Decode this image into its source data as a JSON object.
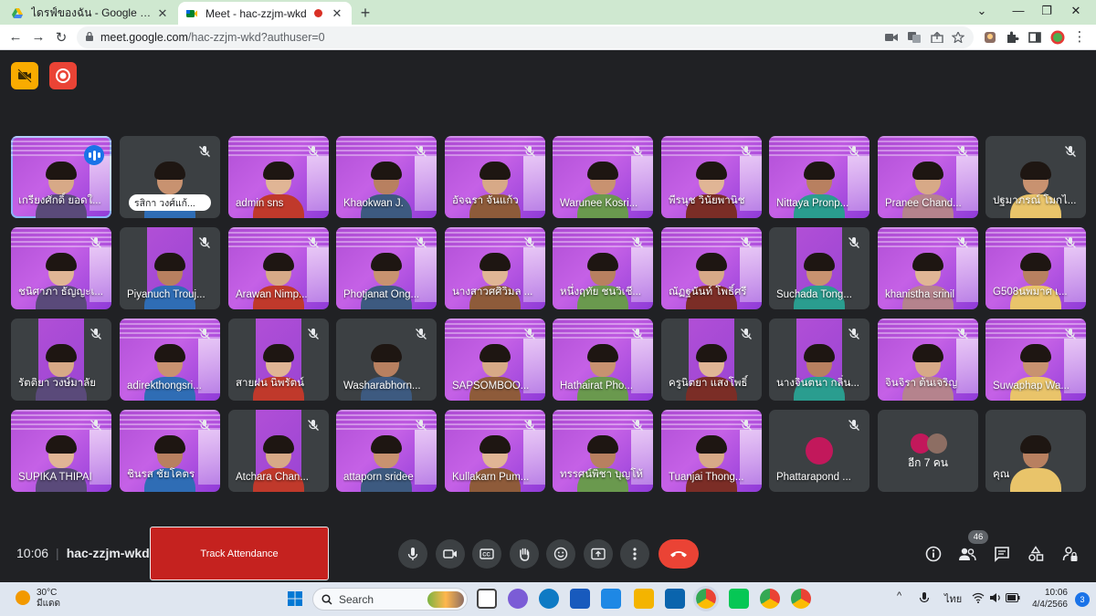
{
  "browser": {
    "tabs": [
      {
        "title": "ไดรฟ์ของฉัน - Google ไดรฟ์",
        "close": "✕"
      },
      {
        "title": "Meet - hac-zzjm-wkd",
        "close": "✕"
      }
    ],
    "new_tab": "+",
    "window_controls": {
      "collapse": "⌄",
      "minimize": "—",
      "maximize": "❐",
      "close": "✕"
    },
    "nav": {
      "back": "←",
      "forward": "→",
      "reload": "↻"
    },
    "url_host": "meet.google.com",
    "url_path": "/hac-zzjm-wkd?authuser=0",
    "menu": "⋮"
  },
  "meet": {
    "top_buttons": [
      {
        "name": "camera-off-indicator",
        "color": "#f9ab00"
      },
      {
        "name": "recording-indicator",
        "color": "#ea4335"
      }
    ],
    "participants": [
      {
        "name": "เกรียงศักดิ์ ยอดใ...",
        "style": "slide",
        "speaking": true
      },
      {
        "name": "รสิกา วงศ์แก้...",
        "style": "plain",
        "pill": true
      },
      {
        "name": "admin sns",
        "style": "slide"
      },
      {
        "name": "Khaokwan J.",
        "style": "slide"
      },
      {
        "name": "อัจฉรา จันแก้ว",
        "style": "slide"
      },
      {
        "name": "Warunee Kosri...",
        "style": "slide"
      },
      {
        "name": "พีรนุช วินัยพานิช",
        "style": "slide"
      },
      {
        "name": "Nittaya Pronp...",
        "style": "slide"
      },
      {
        "name": "Pranee Chand...",
        "style": "slide"
      },
      {
        "name": "ปฐมาภรณ์ โมกไ...",
        "style": "plain"
      },
      {
        "name": "ชนิศาภา ธัญญะเ...",
        "style": "slide"
      },
      {
        "name": "Piyanuch Trouj...",
        "style": "half"
      },
      {
        "name": "Arawan Nimp...",
        "style": "slide"
      },
      {
        "name": "Photjanat Ong...",
        "style": "slide"
      },
      {
        "name": "นางสาวศศิวิมล ...",
        "style": "slide"
      },
      {
        "name": "หนึ่งฤทัย ชนวิเชี...",
        "style": "slide"
      },
      {
        "name": "ณัฏฐนันท์ โพธิ์ศรี",
        "style": "slide"
      },
      {
        "name": "Suchada Tong...",
        "style": "half"
      },
      {
        "name": "khanistha srinil",
        "style": "slide"
      },
      {
        "name": "G508นพมาศ เ...",
        "style": "slide"
      },
      {
        "name": "รัตติยา วงษ์มาลัย",
        "style": "half"
      },
      {
        "name": "adirekthongsri...",
        "style": "slide"
      },
      {
        "name": "สายฝน นิพรัตน์",
        "style": "half"
      },
      {
        "name": "Washarabhorn...",
        "style": "plain"
      },
      {
        "name": "SAPSOMBOO...",
        "style": "slide"
      },
      {
        "name": "Hathairat Pho...",
        "style": "slide"
      },
      {
        "name": "ครูนิตยา แสงโพธิ์",
        "style": "half"
      },
      {
        "name": "นางจินตนา กลิ่น...",
        "style": "half"
      },
      {
        "name": "จินจิรา ต้นเจริญ",
        "style": "slide"
      },
      {
        "name": "Suwaphap Wa...",
        "style": "slide"
      },
      {
        "name": "SUPIKA THIPAI",
        "style": "slide"
      },
      {
        "name": "ชินรส ชัยโคตร",
        "style": "slide"
      },
      {
        "name": "Atchara Chan...",
        "style": "half"
      },
      {
        "name": "attaporn sridee",
        "style": "slide"
      },
      {
        "name": "Kullakarn Pum...",
        "style": "slide"
      },
      {
        "name": "ทรรศน์พิชา บุญโห้",
        "style": "slide"
      },
      {
        "name": "Tuanjai Thong...",
        "style": "slide"
      },
      {
        "name": "Phattarapond ...",
        "style": "avatar"
      },
      {
        "name": "อีก 7 คน",
        "style": "more"
      },
      {
        "name": "คุณ",
        "style": "self"
      }
    ],
    "bottom": {
      "time": "10:06",
      "meeting_code": "hac-zzjm-wkd",
      "track_attendance": "Track Attendance",
      "people_count": "46"
    }
  },
  "taskbar": {
    "temperature": "30°C",
    "weather": "มีแดด",
    "search_placeholder": "Search",
    "language": "ไทย",
    "time": "10:06",
    "date": "4/4/2566",
    "notifications": "3"
  },
  "colors": {
    "meet_bg": "#202124",
    "tile_gray": "#3c4043",
    "slide_purple": "#b14fd6",
    "hangup_red": "#ea4335",
    "track_red": "#c5221f",
    "speaking_blue": "#1a73e8"
  }
}
